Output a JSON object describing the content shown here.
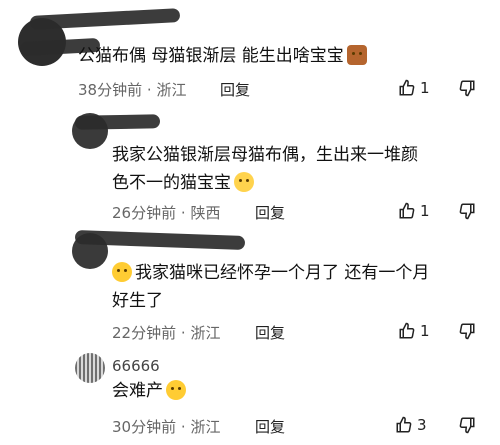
{
  "comments": [
    {
      "username": "",
      "text_lines": [
        "公猫布偶 母猫银渐层 能生出啥宝宝"
      ],
      "emoji": "cat-icon",
      "time": "38分钟前",
      "location": "浙江",
      "reply_label": "回复",
      "likes": "1"
    },
    {
      "username": "",
      "text_lines": [
        "我家公猫银渐层母猫布偶，生出来一堆颜",
        "色不一的猫宝宝"
      ],
      "emoji": "laughing-crying-icon",
      "time": "26分钟前",
      "location": "陕西",
      "reply_label": "回复",
      "likes": "1"
    },
    {
      "username": "",
      "text_lines": [
        "我家猫咪已经怀孕一个月了 还有一个月",
        "好生了"
      ],
      "emoji": "pleading-face-icon",
      "time": "22分钟前",
      "location": "浙江",
      "reply_label": "回复",
      "likes": "1"
    },
    {
      "username": "66666",
      "text_lines": [
        "会难产"
      ],
      "emoji": "sweat-smile-icon",
      "time": "30分钟前",
      "location": "浙江",
      "reply_label": "回复",
      "likes": "3"
    }
  ],
  "separator": "·"
}
